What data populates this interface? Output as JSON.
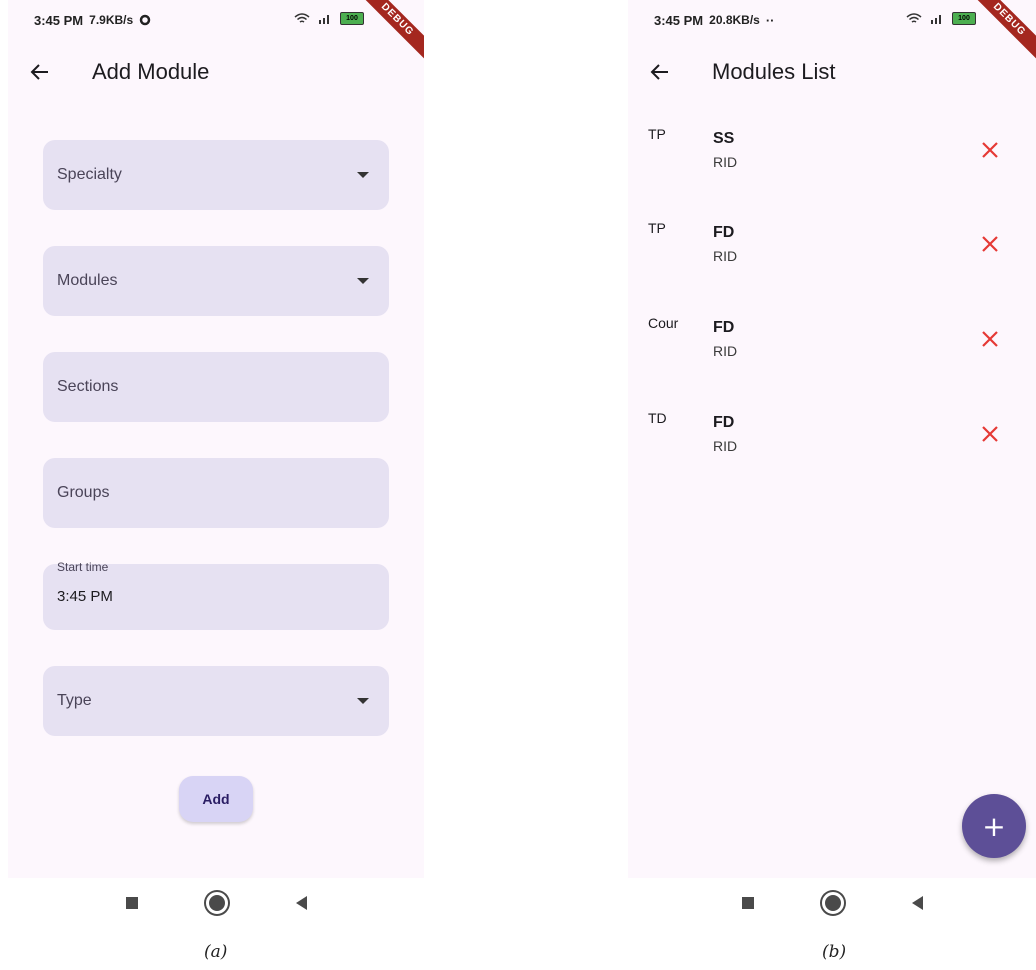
{
  "screen_a": {
    "status": {
      "time": "3:45 PM",
      "speed": "7.9KB/s",
      "battery": "100"
    },
    "debug_banner": "DEBUG",
    "title": "Add Module",
    "fields": {
      "specialty": "Specialty",
      "modules": "Modules",
      "sections": "Sections",
      "groups": "Groups",
      "start_time_label": "Start time",
      "start_time_value": "3:45 PM",
      "type": "Type"
    },
    "add_label": "Add",
    "caption": "(a)"
  },
  "screen_b": {
    "status": {
      "time": "3:45 PM",
      "speed": "20.8KB/s",
      "battery": "100"
    },
    "debug_banner": "DEBUG",
    "title": "Modules List",
    "items": [
      {
        "type": "TP",
        "title": "SS",
        "subtitle": "RID"
      },
      {
        "type": "TP",
        "title": "FD",
        "subtitle": "RID"
      },
      {
        "type": "Cour",
        "title": "FD",
        "subtitle": "RID"
      },
      {
        "type": "TD",
        "title": "FD",
        "subtitle": "RID"
      }
    ],
    "fab_icon": "+",
    "caption": "(b)"
  },
  "colors": {
    "background": "#fdf7fd",
    "field": "#e6e1f2",
    "button": "#d8d4f5",
    "fab": "#5d4f97",
    "delete": "#e53935"
  },
  "icons": [
    "back-arrow-icon",
    "dropdown-caret-icon",
    "close-icon",
    "plus-icon",
    "wifi-icon",
    "signal-icon",
    "battery-icon",
    "settings-icon"
  ]
}
